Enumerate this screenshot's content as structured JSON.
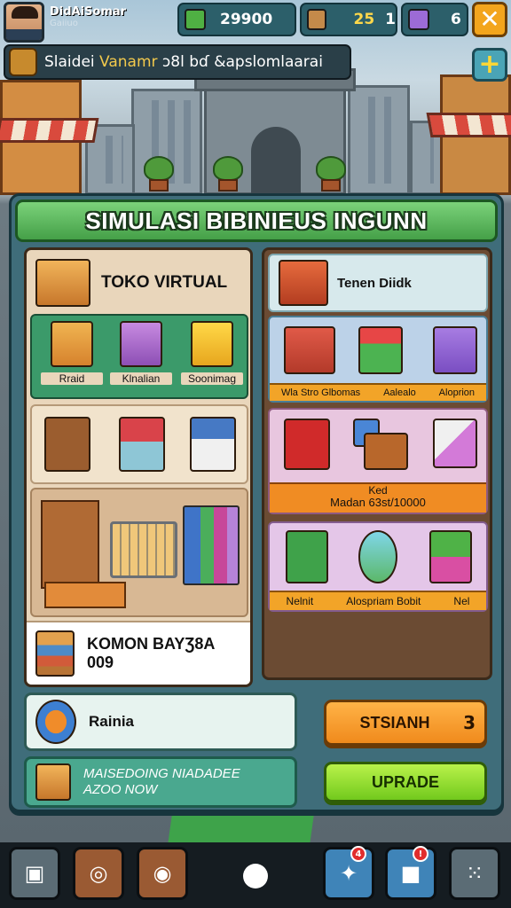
{
  "header": {
    "player_name": "DidAiSomar",
    "player_sub": "Gaiiuo",
    "cash": "29900",
    "resource_2": {
      "value_a": "25",
      "value_b": "1"
    },
    "resource_3": "6",
    "close_glyph": "✕"
  },
  "news": {
    "prefix": "Slaidei",
    "highlight": "Vanamr",
    "rest": "ɔ8l bɗ &apslomlaarai"
  },
  "plus_glyph": "+",
  "panel": {
    "title": "SIMULASI BIBINIEUS INGUNN",
    "left": {
      "heading": "TOKO VIRTUAL",
      "categories": [
        "Rraid",
        "Klnalian",
        "Soonimag"
      ],
      "bottom_line1": "KOMON BAYƷ8A",
      "bottom_line2": "009"
    },
    "right": {
      "heading": "Tenen Diidk",
      "categories": [
        "Wla Stro Glbomas",
        "Aalealo",
        "Aloprion"
      ],
      "accessory_line1": "Ked",
      "accessory_line2": "Madan 63st/10000",
      "books": [
        "Nelnit",
        "Alospriam Bobit",
        "Nel"
      ]
    },
    "status_label": "Rainia",
    "promo_line1": "MAISEDOING NIADADEE",
    "promo_line2": "AZOO NOW",
    "start_label": "STSIANH",
    "start_count": "3",
    "upgrade_label": "UPRADE"
  },
  "bottom_bar": {
    "badge_1": "4",
    "badge_2": "!"
  },
  "icons": {
    "cash": "money-plant-icon",
    "resource_2": "crate-icon",
    "resource_3": "gem-box-icon"
  },
  "colors": {
    "title_bar": "#45a048",
    "start_button": "#f08a1c",
    "upgrade_button": "#72c91d",
    "close_button": "#f3a51d"
  }
}
